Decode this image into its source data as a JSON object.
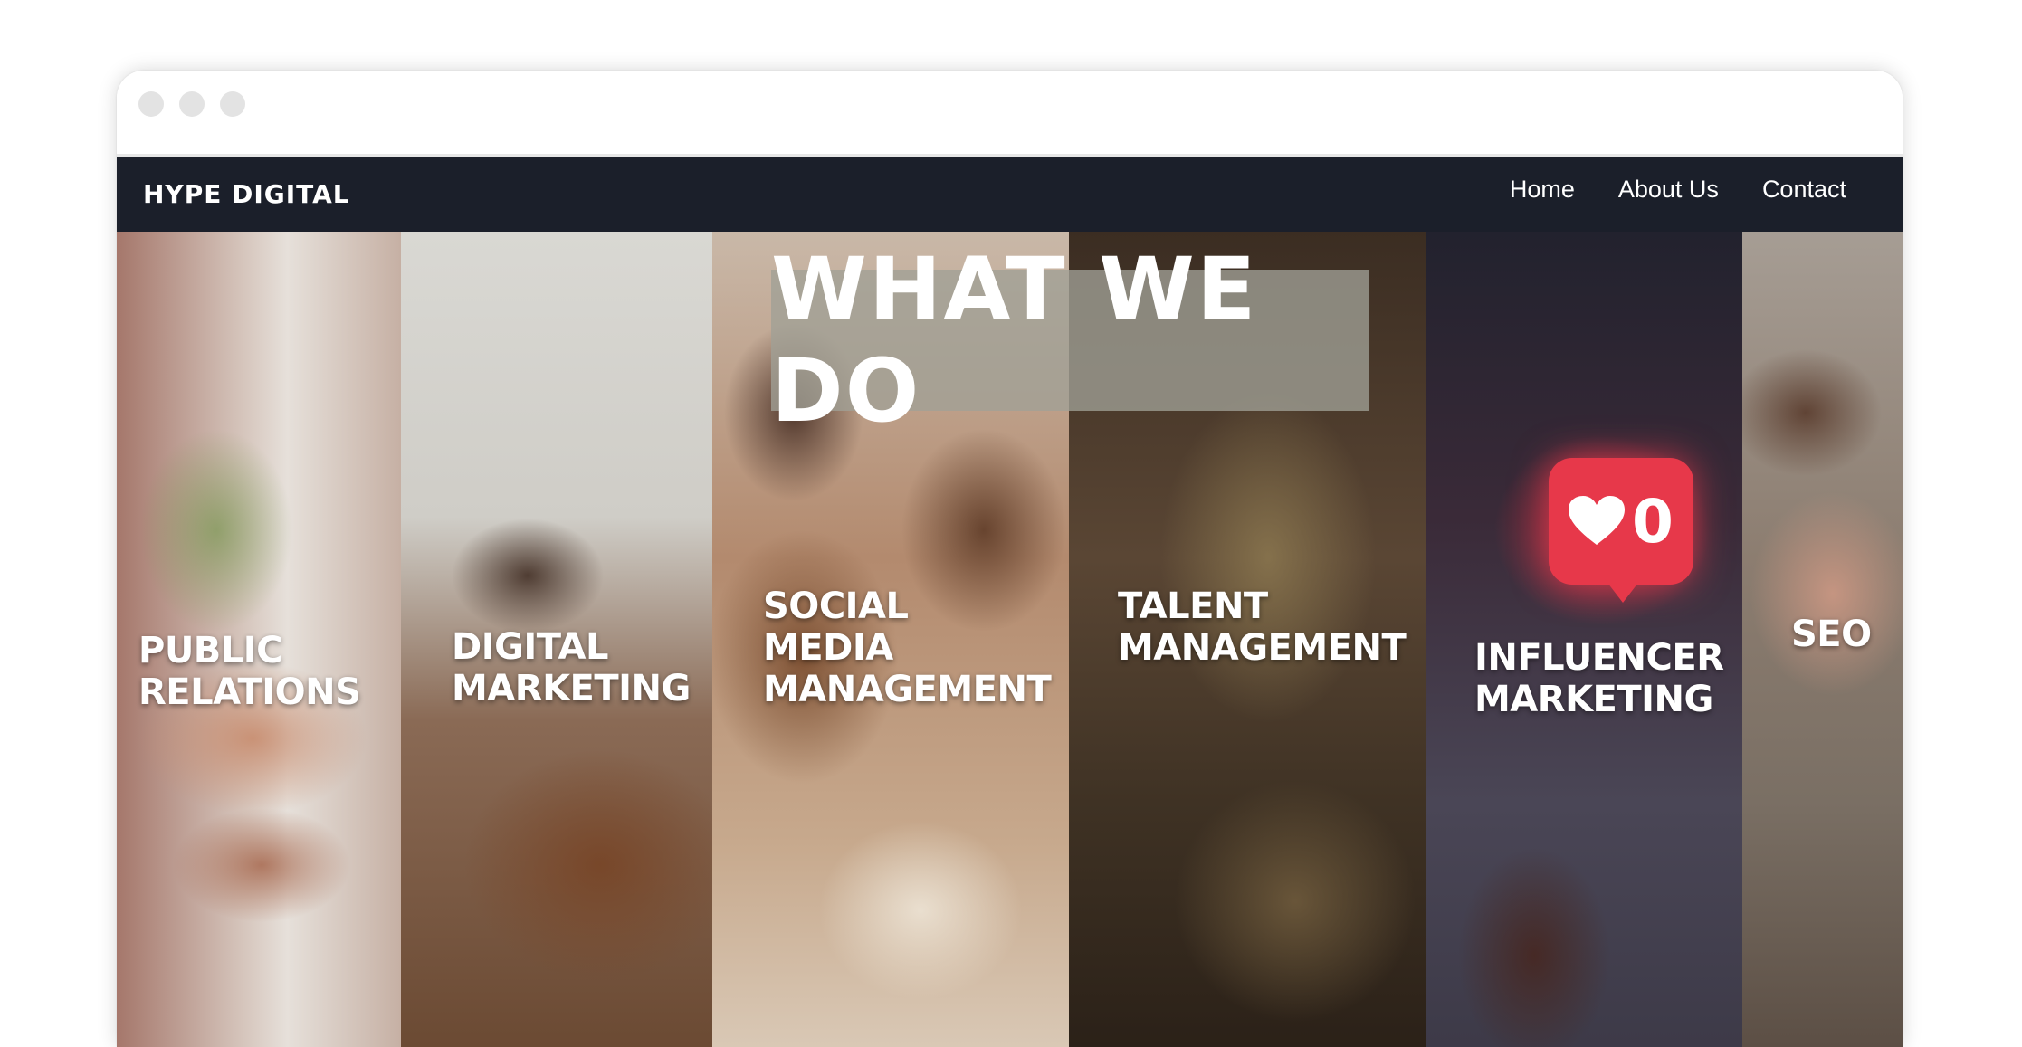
{
  "window": {
    "controls": [
      "close",
      "minimize",
      "maximize"
    ]
  },
  "nav": {
    "brand": "HYPE DIGITAL",
    "links": [
      "Home",
      "About Us",
      "Contact"
    ]
  },
  "hero": {
    "heading": "WHAT WE DO",
    "panels": [
      {
        "lines": [
          "PUBLIC",
          "RELATIONS"
        ]
      },
      {
        "lines": [
          "DIGITAL",
          "MARKETING"
        ]
      },
      {
        "lines": [
          "SOCIAL",
          "MEDIA",
          "MANAGEMENT"
        ]
      },
      {
        "lines": [
          "TALENT",
          "MANAGEMENT"
        ]
      },
      {
        "lines": [
          "INFLUENCER",
          "MARKETING"
        ],
        "notification_count": "0"
      },
      {
        "lines": [
          "SEO"
        ]
      }
    ]
  },
  "colors": {
    "navbar_bg": "#1b1f2a",
    "notification_red": "#e7384a"
  }
}
